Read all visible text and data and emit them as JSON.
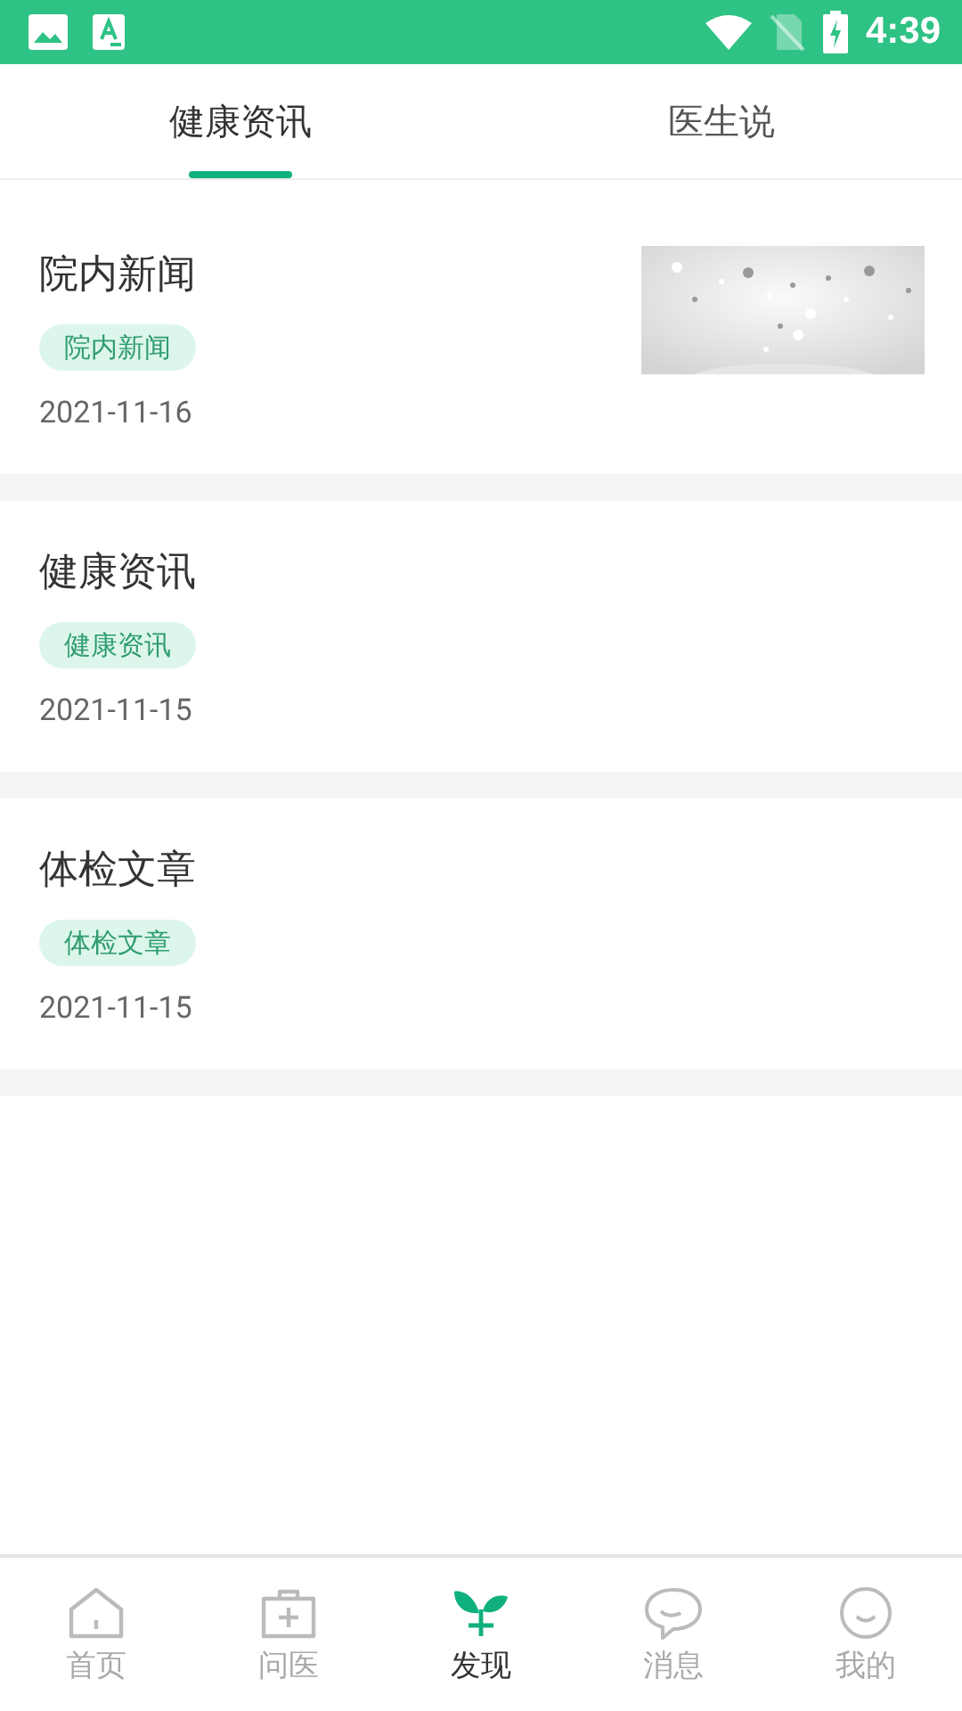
{
  "status_bar": {
    "time": "4:39"
  },
  "tabs": [
    {
      "label": "健康资讯",
      "selected": true
    },
    {
      "label": "医生说",
      "selected": false
    }
  ],
  "articles": [
    {
      "title": "院内新闻",
      "tag": "院内新闻",
      "date": "2021-11-16"
    },
    {
      "title": "健康资讯",
      "tag": "健康资讯",
      "date": "2021-11-15"
    },
    {
      "title": "体检文章",
      "tag": "体检文章",
      "date": "2021-11-15"
    }
  ],
  "bottom_nav": [
    {
      "label": "首页",
      "selected": false
    },
    {
      "label": "问医",
      "selected": false
    },
    {
      "label": "发现",
      "selected": true
    },
    {
      "label": "消息",
      "selected": false
    },
    {
      "label": "我的",
      "selected": false
    }
  ]
}
